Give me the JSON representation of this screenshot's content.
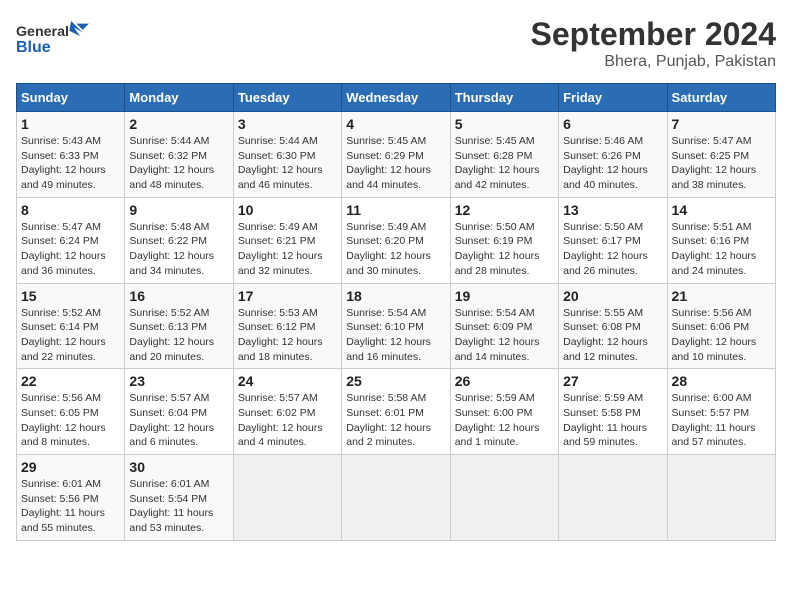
{
  "header": {
    "logo_general": "General",
    "logo_blue": "Blue",
    "title": "September 2024",
    "subtitle": "Bhera, Punjab, Pakistan"
  },
  "weekdays": [
    "Sunday",
    "Monday",
    "Tuesday",
    "Wednesday",
    "Thursday",
    "Friday",
    "Saturday"
  ],
  "weeks": [
    [
      {
        "day": "1",
        "info": "Sunrise: 5:43 AM\nSunset: 6:33 PM\nDaylight: 12 hours\nand 49 minutes."
      },
      {
        "day": "2",
        "info": "Sunrise: 5:44 AM\nSunset: 6:32 PM\nDaylight: 12 hours\nand 48 minutes."
      },
      {
        "day": "3",
        "info": "Sunrise: 5:44 AM\nSunset: 6:30 PM\nDaylight: 12 hours\nand 46 minutes."
      },
      {
        "day": "4",
        "info": "Sunrise: 5:45 AM\nSunset: 6:29 PM\nDaylight: 12 hours\nand 44 minutes."
      },
      {
        "day": "5",
        "info": "Sunrise: 5:45 AM\nSunset: 6:28 PM\nDaylight: 12 hours\nand 42 minutes."
      },
      {
        "day": "6",
        "info": "Sunrise: 5:46 AM\nSunset: 6:26 PM\nDaylight: 12 hours\nand 40 minutes."
      },
      {
        "day": "7",
        "info": "Sunrise: 5:47 AM\nSunset: 6:25 PM\nDaylight: 12 hours\nand 38 minutes."
      }
    ],
    [
      {
        "day": "8",
        "info": "Sunrise: 5:47 AM\nSunset: 6:24 PM\nDaylight: 12 hours\nand 36 minutes."
      },
      {
        "day": "9",
        "info": "Sunrise: 5:48 AM\nSunset: 6:22 PM\nDaylight: 12 hours\nand 34 minutes."
      },
      {
        "day": "10",
        "info": "Sunrise: 5:49 AM\nSunset: 6:21 PM\nDaylight: 12 hours\nand 32 minutes."
      },
      {
        "day": "11",
        "info": "Sunrise: 5:49 AM\nSunset: 6:20 PM\nDaylight: 12 hours\nand 30 minutes."
      },
      {
        "day": "12",
        "info": "Sunrise: 5:50 AM\nSunset: 6:19 PM\nDaylight: 12 hours\nand 28 minutes."
      },
      {
        "day": "13",
        "info": "Sunrise: 5:50 AM\nSunset: 6:17 PM\nDaylight: 12 hours\nand 26 minutes."
      },
      {
        "day": "14",
        "info": "Sunrise: 5:51 AM\nSunset: 6:16 PM\nDaylight: 12 hours\nand 24 minutes."
      }
    ],
    [
      {
        "day": "15",
        "info": "Sunrise: 5:52 AM\nSunset: 6:14 PM\nDaylight: 12 hours\nand 22 minutes."
      },
      {
        "day": "16",
        "info": "Sunrise: 5:52 AM\nSunset: 6:13 PM\nDaylight: 12 hours\nand 20 minutes."
      },
      {
        "day": "17",
        "info": "Sunrise: 5:53 AM\nSunset: 6:12 PM\nDaylight: 12 hours\nand 18 minutes."
      },
      {
        "day": "18",
        "info": "Sunrise: 5:54 AM\nSunset: 6:10 PM\nDaylight: 12 hours\nand 16 minutes."
      },
      {
        "day": "19",
        "info": "Sunrise: 5:54 AM\nSunset: 6:09 PM\nDaylight: 12 hours\nand 14 minutes."
      },
      {
        "day": "20",
        "info": "Sunrise: 5:55 AM\nSunset: 6:08 PM\nDaylight: 12 hours\nand 12 minutes."
      },
      {
        "day": "21",
        "info": "Sunrise: 5:56 AM\nSunset: 6:06 PM\nDaylight: 12 hours\nand 10 minutes."
      }
    ],
    [
      {
        "day": "22",
        "info": "Sunrise: 5:56 AM\nSunset: 6:05 PM\nDaylight: 12 hours\nand 8 minutes."
      },
      {
        "day": "23",
        "info": "Sunrise: 5:57 AM\nSunset: 6:04 PM\nDaylight: 12 hours\nand 6 minutes."
      },
      {
        "day": "24",
        "info": "Sunrise: 5:57 AM\nSunset: 6:02 PM\nDaylight: 12 hours\nand 4 minutes."
      },
      {
        "day": "25",
        "info": "Sunrise: 5:58 AM\nSunset: 6:01 PM\nDaylight: 12 hours\nand 2 minutes."
      },
      {
        "day": "26",
        "info": "Sunrise: 5:59 AM\nSunset: 6:00 PM\nDaylight: 12 hours\nand 1 minute."
      },
      {
        "day": "27",
        "info": "Sunrise: 5:59 AM\nSunset: 5:58 PM\nDaylight: 11 hours\nand 59 minutes."
      },
      {
        "day": "28",
        "info": "Sunrise: 6:00 AM\nSunset: 5:57 PM\nDaylight: 11 hours\nand 57 minutes."
      }
    ],
    [
      {
        "day": "29",
        "info": "Sunrise: 6:01 AM\nSunset: 5:56 PM\nDaylight: 11 hours\nand 55 minutes."
      },
      {
        "day": "30",
        "info": "Sunrise: 6:01 AM\nSunset: 5:54 PM\nDaylight: 11 hours\nand 53 minutes."
      },
      {
        "day": "",
        "info": ""
      },
      {
        "day": "",
        "info": ""
      },
      {
        "day": "",
        "info": ""
      },
      {
        "day": "",
        "info": ""
      },
      {
        "day": "",
        "info": ""
      }
    ]
  ]
}
